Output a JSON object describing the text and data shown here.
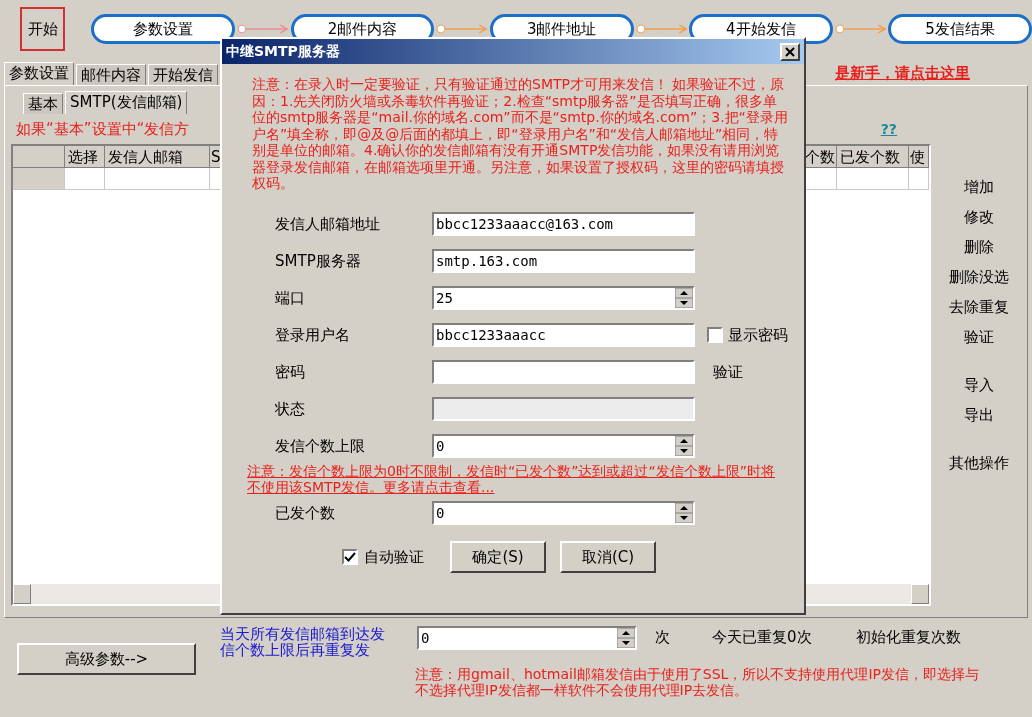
{
  "start_button": "开始",
  "steps": [
    {
      "label": "参数设置"
    },
    {
      "label": "2邮件内容"
    },
    {
      "label": "3邮件地址"
    },
    {
      "label": "4开始发信"
    },
    {
      "label": "5发信结果"
    }
  ],
  "main_tabs": [
    {
      "label": "参数设置",
      "selected": true
    },
    {
      "label": "邮件内容",
      "selected": false
    },
    {
      "label": "开始发信",
      "selected": false
    }
  ],
  "newbie_link": "是新手，请点击这里",
  "sub_tabs": [
    {
      "label": "基本",
      "selected": false
    },
    {
      "label": "SMTP(发信邮箱)",
      "selected": true
    }
  ],
  "hint": "如果“基本”设置中“发信方",
  "help_link": "??",
  "table": {
    "columns_left": [
      "选择",
      "发信人邮箱",
      "S"
    ],
    "columns_right": [
      "个数",
      "已发个数",
      "使"
    ]
  },
  "side_actions": [
    [
      "增加",
      "修改",
      "删除",
      "删除没选",
      "去除重复",
      "验证"
    ],
    [
      "导入",
      "导出"
    ],
    [
      "其他操作"
    ]
  ],
  "advanced_button": "高级参数-->",
  "repeat": {
    "label": "当天所有发信邮箱到达发信个数上限后再重复发",
    "value": "0",
    "unit": "次",
    "today": "今天已重复0次",
    "reset": "初始化重复次数"
  },
  "proxy_note": "注意：用gmail、hotmail邮箱发信由于使用了SSL，所以不支持使用代理IP发信，即选择与不选择代理IP发信都一样软件不会使用代理IP去发信。",
  "dialog": {
    "title": "中继SMTP服务器",
    "notice": "注意：在录入时一定要验证，只有验证通过的SMTP才可用来发信！ 如果验证不过，原因：1.先关闭防火墙或杀毒软件再验证；2.检查“smtp服务器”是否填写正确，很多单位的smtp服务器是“mail.你的域名.com”而不是“smtp.你的域名.com”；3.把“登录用户名”填全称，即@及@后面的都填上，即“登录用户名”和“发信人邮箱地址”相同，特别是单位的邮箱。4.确认你的发信邮箱有没有开通SMTP发信功能，如果没有请用浏览器登录发信邮箱，在邮箱选项里开通。另注意，如果设置了授权码，这里的密码请填授权码。",
    "fields": [
      {
        "label": "发信人邮箱地址",
        "kind": "text",
        "value": "bbcc1233aaacc@163.com"
      },
      {
        "label": "SMTP服务器",
        "kind": "text",
        "value": "smtp.163.com"
      },
      {
        "label": "端口",
        "kind": "spin",
        "value": "25"
      },
      {
        "label": "登录用户名",
        "kind": "text",
        "value": "bbcc1233aaacc",
        "option": {
          "label": "显示密码",
          "checked": false
        }
      },
      {
        "label": "密码",
        "kind": "text",
        "action": "验证"
      },
      {
        "label": "状态",
        "kind": "readonly"
      },
      {
        "label": "发信个数上限",
        "kind": "spin",
        "value": "0",
        "note": "注意：发信个数上限为0时不限制，发信时“已发个数”达到或超过“发信个数上限”时将不使用该SMTP发信。更多请点击查看..."
      },
      {
        "label": "已发个数",
        "kind": "spin",
        "value": "0"
      }
    ],
    "auto_verify": {
      "label": "自动验证",
      "checked": true
    },
    "buttons": [
      "确定(S)",
      "取消(C)"
    ]
  }
}
